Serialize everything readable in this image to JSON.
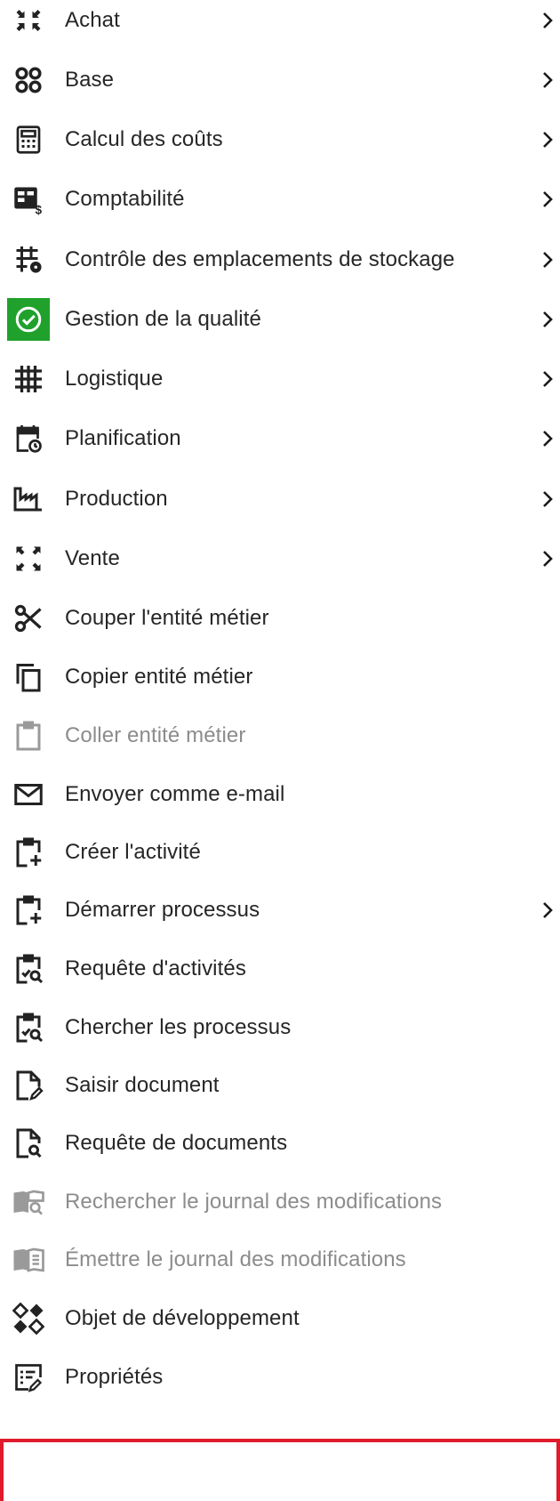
{
  "menu": {
    "items": [
      {
        "label": "Achat",
        "icon": "collapse-arrows-icon",
        "submenu": true
      },
      {
        "label": "Base",
        "icon": "four-circles-icon",
        "submenu": true
      },
      {
        "label": "Calcul des coûts",
        "icon": "calculator-icon",
        "submenu": true
      },
      {
        "label": "Comptabilité",
        "icon": "ledger-dollar-icon",
        "submenu": true
      },
      {
        "label": "Contrôle des emplacements de stockage",
        "icon": "grid-gear-icon",
        "submenu": true
      },
      {
        "label": "Gestion de la qualité",
        "icon": "check-circle-icon",
        "submenu": true
      },
      {
        "label": "Logistique",
        "icon": "grid-icon",
        "submenu": true
      },
      {
        "label": "Planification",
        "icon": "calendar-clock-icon",
        "submenu": true
      },
      {
        "label": "Production",
        "icon": "factory-icon",
        "submenu": true
      },
      {
        "label": "Vente",
        "icon": "expand-arrows-icon",
        "submenu": true
      },
      {
        "label": "Couper l'entité métier",
        "icon": "scissors-icon",
        "submenu": false
      },
      {
        "label": "Copier entité métier",
        "icon": "copy-icon",
        "submenu": false
      },
      {
        "label": "Coller entité métier",
        "icon": "clipboard-icon",
        "submenu": false,
        "disabled": true
      },
      {
        "label": "Envoyer comme e-mail",
        "icon": "envelope-icon",
        "submenu": false
      },
      {
        "label": "Créer l'activité",
        "icon": "clipboard-plus-icon",
        "submenu": false
      },
      {
        "label": "Démarrer processus",
        "icon": "clipboard-plus-icon",
        "submenu": true
      },
      {
        "label": "Requête d'activités",
        "icon": "clipboard-search-icon",
        "submenu": false
      },
      {
        "label": "Chercher les processus",
        "icon": "clipboard-search-icon",
        "submenu": false
      },
      {
        "label": "Saisir document",
        "icon": "document-pen-icon",
        "submenu": false
      },
      {
        "label": "Requête de documents",
        "icon": "document-search-icon",
        "submenu": false
      },
      {
        "label": "Rechercher le journal des modifications",
        "icon": "book-search-icon",
        "submenu": false,
        "disabled": true
      },
      {
        "label": "Émettre le journal des modifications",
        "icon": "book-icon",
        "submenu": false,
        "disabled": true
      },
      {
        "label": "Objet de développement",
        "icon": "diamonds-icon",
        "submenu": false
      },
      {
        "label": "Propriétés",
        "icon": "properties-icon",
        "submenu": false,
        "highlighted": true
      }
    ]
  },
  "colors": {
    "text": "#262626",
    "disabled_text": "#8c8c8c",
    "quality_green": "#1fa12b",
    "highlight_border": "#e01b2c"
  }
}
